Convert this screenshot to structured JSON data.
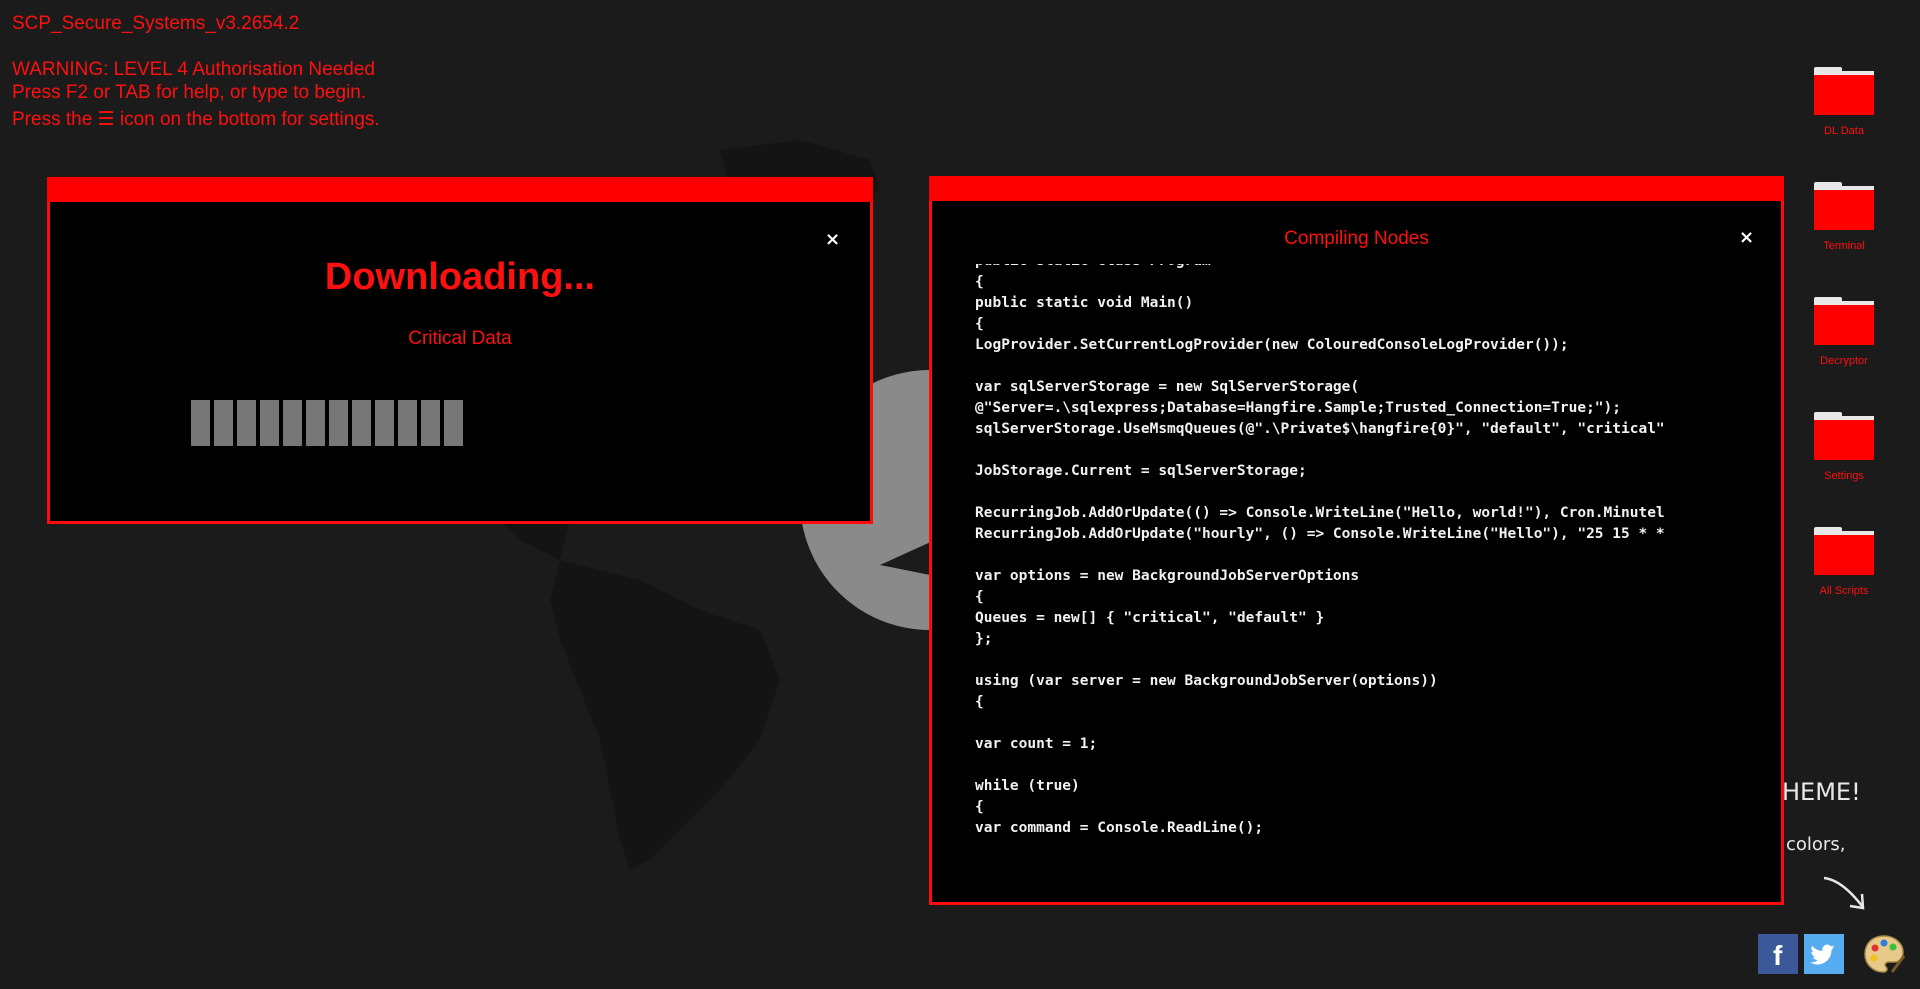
{
  "system": {
    "title": "SCP_Secure_Systems_v3.2654.2",
    "warning": "WARNING: LEVEL 4 Authorisation Needed",
    "help_line": "Press F2 or TAB for help, or type to begin.",
    "settings_line": "Press the ☰ icon on the bottom for settings."
  },
  "background_hint": {
    "line1": "HEME!",
    "line2": "colors,"
  },
  "download_window": {
    "close_label": "×",
    "heading": "Downloading...",
    "subtitle": "Critical Data",
    "progress_segments": 12
  },
  "compile_window": {
    "title": "Compiling Nodes",
    "close_label": "×",
    "code_lines": [
      "public static class Program",
      "{",
      "public static void Main()",
      "{",
      "LogProvider.SetCurrentLogProvider(new ColouredConsoleLogProvider());",
      "",
      "var sqlServerStorage = new SqlServerStorage(",
      "@\"Server=.\\sqlexpress;Database=Hangfire.Sample;Trusted_Connection=True;\");",
      "sqlServerStorage.UseMsmqQueues(@\".\\Private$\\hangfire{0}\", \"default\", \"critical\"",
      "",
      "JobStorage.Current = sqlServerStorage;",
      "",
      "RecurringJob.AddOrUpdate(() => Console.WriteLine(\"Hello, world!\"), Cron.Minutel",
      "RecurringJob.AddOrUpdate(\"hourly\", () => Console.WriteLine(\"Hello\"), \"25 15 * *",
      "",
      "var options = new BackgroundJobServerOptions",
      "{",
      "Queues = new[] { \"critical\", \"default\" }",
      "};",
      "",
      "using (var server = new BackgroundJobServer(options))",
      "{",
      "",
      "var count = 1;",
      "",
      "while (true)",
      "{",
      "var command = Console.ReadLine();"
    ]
  },
  "desktop_icons": [
    {
      "label": "DL Data"
    },
    {
      "label": "Terminal"
    },
    {
      "label": "Decryptor"
    },
    {
      "label": "Settings"
    },
    {
      "label": "All Scripts"
    }
  ],
  "social": {
    "facebook_glyph": "f"
  },
  "colors": {
    "background": "#1b1b1b",
    "accent_red": "#ff0000",
    "window_bg": "#000000",
    "code_text": "#f2f2f2",
    "progress_segment": "#777777",
    "facebook": "#3b5998",
    "twitter": "#55acee"
  }
}
